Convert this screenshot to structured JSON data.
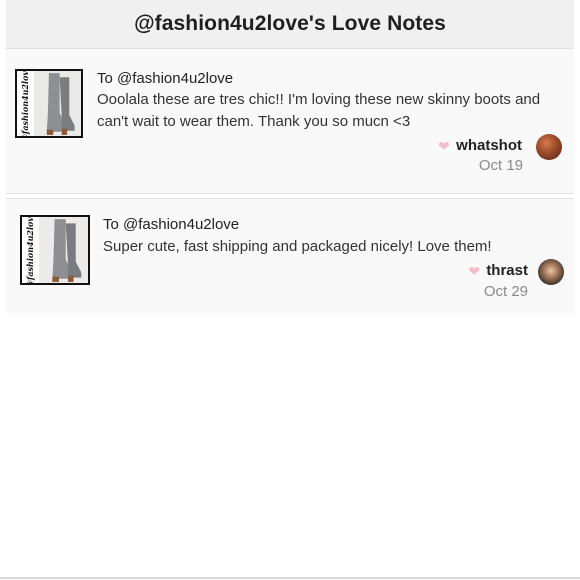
{
  "header": {
    "title": "@fashion4u2love's Love Notes"
  },
  "notes": [
    {
      "thumb_handle": "@fashion4u2love",
      "to": "To @fashion4u2love",
      "message": "Ooolala these are tres chic!! I'm loving these new skinny boots and can't wait to wear them. Thank you so mucn <3",
      "author": "whatshot",
      "date": "Oct 19"
    },
    {
      "thumb_handle": "@fashion4u2love",
      "to": "To @fashion4u2love",
      "message": "Super cute, fast shipping and packaged nicely! Love them!",
      "author": "thrast",
      "date": "Oct 29"
    }
  ],
  "icons": {
    "like": "heart-icon",
    "user": "avatar"
  },
  "colors": {
    "heart": "#f3bccb",
    "header_bg": "#f1f0f0",
    "card_bg": "#faf9fa",
    "date": "#8a8a8a"
  }
}
